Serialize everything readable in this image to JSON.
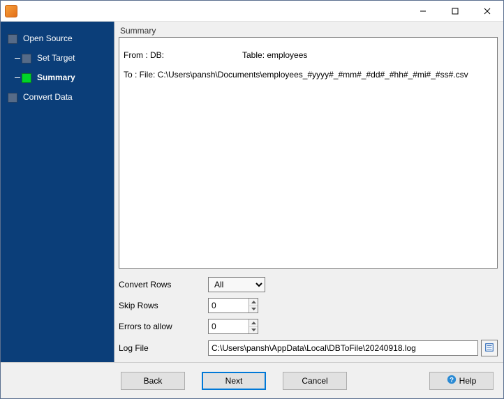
{
  "sidebar": {
    "items": [
      {
        "label": "Open Source",
        "selected": false,
        "sub": false,
        "green": false
      },
      {
        "label": "Set Target",
        "selected": false,
        "sub": true,
        "green": false
      },
      {
        "label": "Summary",
        "selected": true,
        "sub": true,
        "green": true
      },
      {
        "label": "Convert Data",
        "selected": false,
        "sub": false,
        "green": false
      }
    ]
  },
  "summary": {
    "group_label": "Summary",
    "from_label": "From : DB:",
    "table_label": "Table: employees",
    "to_line": "To : File: C:\\Users\\pansh\\Documents\\employees_#yyyy#_#mm#_#dd#_#hh#_#mi#_#ss#.csv"
  },
  "form": {
    "convert_rows_label": "Convert Rows",
    "convert_rows_value": "All",
    "skip_rows_label": "Skip Rows",
    "skip_rows_value": "0",
    "errors_label": "Errors to allow",
    "errors_value": "0",
    "log_label": "Log File",
    "log_value": "C:\\Users\\pansh\\AppData\\Local\\DBToFile\\20240918.log"
  },
  "buttons": {
    "back": "Back",
    "next": "Next",
    "cancel": "Cancel",
    "help": "Help"
  }
}
